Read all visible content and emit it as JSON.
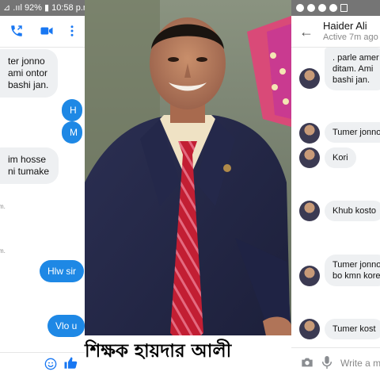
{
  "left_panel": {
    "status_text": "⊿ .ııl 92% ▮ 10:58 p.m",
    "incoming_1": [
      "ter jonno",
      "ami ontor",
      "bashi jan."
    ],
    "outgoing_1": "H",
    "outgoing_2": "M",
    "incoming_2": [
      "im  hosse",
      "ni tumake"
    ],
    "meta_1": "m.",
    "meta_2": "m.",
    "outgoing_3": "Hlw sir",
    "outgoing_4": "Vlo u"
  },
  "caption": {
    "text": "শিক্ষক হায়দার আলী"
  },
  "right_panel": {
    "contact_name": "Haider Ali",
    "active_status": "Active 7m ago",
    "incoming_1": [
      ". parle amer",
      "ditam. Ami",
      "bashi jan."
    ],
    "msg_2": "Tumer jonno",
    "msg_3": "Kori",
    "msg_4": "Khub kosto",
    "msg_5": [
      "Tumer jonno",
      "bo kmn kore"
    ],
    "msg_6": "Tumer  kost",
    "composer_placeholder": "Write a m"
  },
  "colors": {
    "accent_blue": "#1e88e5",
    "status_bar": "#757575",
    "bubble_gray": "#eef0f2"
  }
}
